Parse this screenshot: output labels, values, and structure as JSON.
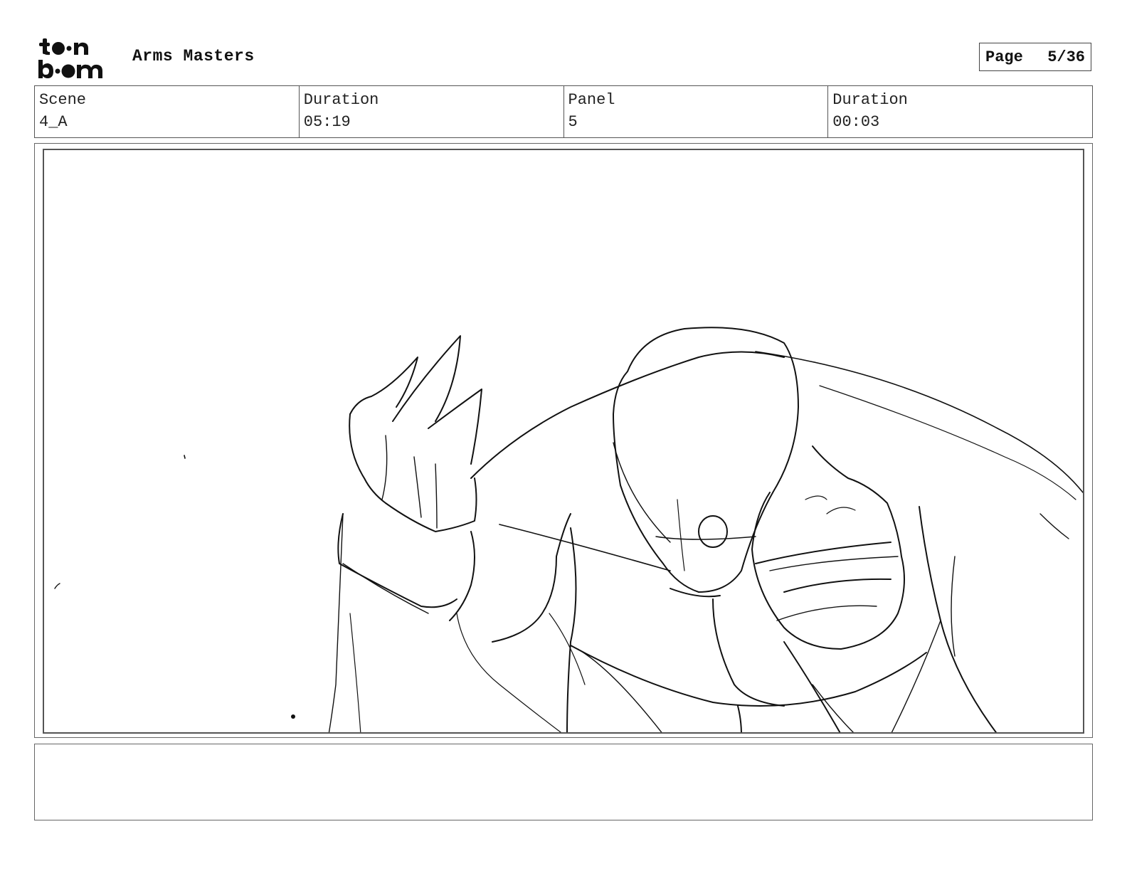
{
  "header": {
    "logo_text": "toon boom",
    "project_title": "Arms Masters",
    "page_label": "Page",
    "page_value": "5/36"
  },
  "info": {
    "scene_label": "Scene",
    "scene_value": "4_A",
    "scene_duration_label": "Duration",
    "scene_duration_value": "05:19",
    "panel_label": "Panel",
    "panel_value": "5",
    "panel_duration_label": "Duration",
    "panel_duration_value": "00:03"
  },
  "panel": {
    "image_kind": "rough pencil sketch"
  },
  "notes": {
    "text": ""
  }
}
